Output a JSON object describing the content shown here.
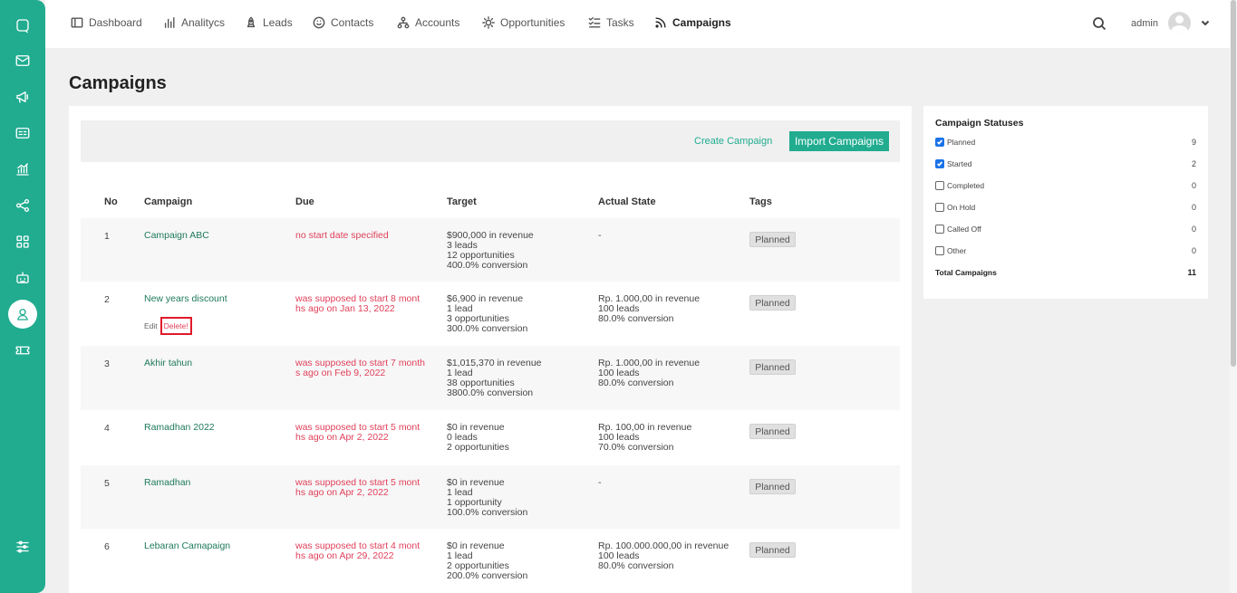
{
  "colors": {
    "accent": "#21ac90",
    "danger": "#e0405a",
    "highlight": "#e01a2a"
  },
  "sidebar": {
    "icons": [
      "chat-icon",
      "mail-icon",
      "megaphone-icon",
      "id-card-icon",
      "chart-icon",
      "share-icon",
      "grid-icon",
      "robot-icon",
      "user-icon",
      "ticket-icon",
      "sliders-icon"
    ],
    "active": "user-icon"
  },
  "nav": {
    "items": [
      {
        "label": "Dashboard",
        "icon": "dashboard-icon"
      },
      {
        "label": "Analitycs",
        "icon": "bar-chart-icon"
      },
      {
        "label": "Leads",
        "icon": "rocket-icon"
      },
      {
        "label": "Contacts",
        "icon": "smile-icon"
      },
      {
        "label": "Accounts",
        "icon": "hierarchy-icon"
      },
      {
        "label": "Opportunities",
        "icon": "sun-icon"
      },
      {
        "label": "Tasks",
        "icon": "checklist-icon"
      },
      {
        "label": "Campaigns",
        "icon": "rss-icon"
      }
    ],
    "active": "Campaigns",
    "username": "admin"
  },
  "page": {
    "title": "Campaigns"
  },
  "toolbar": {
    "create_label": "Create Campaign",
    "import_label": "Import Campaigns"
  },
  "table": {
    "headers": {
      "no": "No",
      "campaign": "Campaign",
      "due": "Due",
      "target": "Target",
      "actual": "Actual State",
      "tags": "Tags"
    },
    "rows": [
      {
        "no": "1",
        "name": "Campaign ABC",
        "due": [
          "no start date specified"
        ],
        "target": [
          "$900,000 in revenue",
          "3 leads",
          "12 opportunities",
          "400.0% conversion"
        ],
        "actual": [
          "-"
        ],
        "tag": "Planned"
      },
      {
        "no": "2",
        "name": "New years discount",
        "due": [
          "was supposed to start 8 mont",
          "hs ago on Jan 13, 2022"
        ],
        "target": [
          "$6,900 in revenue",
          "1 lead",
          "3 opportunities",
          "300.0% conversion"
        ],
        "actual": [
          "Rp. 1.000,00 in revenue",
          "100 leads",
          "80.0% conversion"
        ],
        "tag": "Planned",
        "edit_label": "Edit",
        "delete_label": "Delete!"
      },
      {
        "no": "3",
        "name": "Akhir tahun",
        "due": [
          "was supposed to start 7 month",
          "s ago on Feb 9, 2022"
        ],
        "target": [
          "$1,015,370 in revenue",
          "1 lead",
          "38 opportunities",
          "3800.0% conversion"
        ],
        "actual": [
          "Rp. 1.000,00 in revenue",
          "100 leads",
          "80.0% conversion"
        ],
        "tag": "Planned"
      },
      {
        "no": "4",
        "name": "Ramadhan 2022",
        "due": [
          "was supposed to start 5 mont",
          "hs ago on Apr 2, 2022"
        ],
        "target": [
          "$0 in revenue",
          "0 leads",
          "2 opportunities"
        ],
        "actual": [
          "Rp. 100,00 in revenue",
          "100 leads",
          "70.0% conversion"
        ],
        "tag": "Planned"
      },
      {
        "no": "5",
        "name": "Ramadhan",
        "due": [
          "was supposed to start 5 mont",
          "hs ago on Apr 2, 2022"
        ],
        "target": [
          "$0 in revenue",
          "1 lead",
          "1 opportunity",
          "100.0% conversion"
        ],
        "actual": [
          "-"
        ],
        "tag": "Planned"
      },
      {
        "no": "6",
        "name": "Lebaran Camapaign",
        "due": [
          "was supposed to start 4 mont",
          "hs ago on Apr 29, 2022"
        ],
        "target": [
          "$0 in revenue",
          "1 lead",
          "2 opportunities",
          "200.0% conversion"
        ],
        "actual": [
          "Rp. 100.000.000,00 in revenue",
          "100 leads",
          "80.0% conversion"
        ],
        "tag": "Planned"
      }
    ]
  },
  "statuses": {
    "title": "Campaign Statuses",
    "items": [
      {
        "label": "Planned",
        "count": "9",
        "checked": true
      },
      {
        "label": "Started",
        "count": "2",
        "checked": true
      },
      {
        "label": "Completed",
        "count": "0",
        "checked": false
      },
      {
        "label": "On Hold",
        "count": "0",
        "checked": false
      },
      {
        "label": "Called Off",
        "count": "0",
        "checked": false
      },
      {
        "label": "Other",
        "count": "0",
        "checked": false
      }
    ],
    "total_label": "Total Campaigns",
    "total_count": "11"
  }
}
